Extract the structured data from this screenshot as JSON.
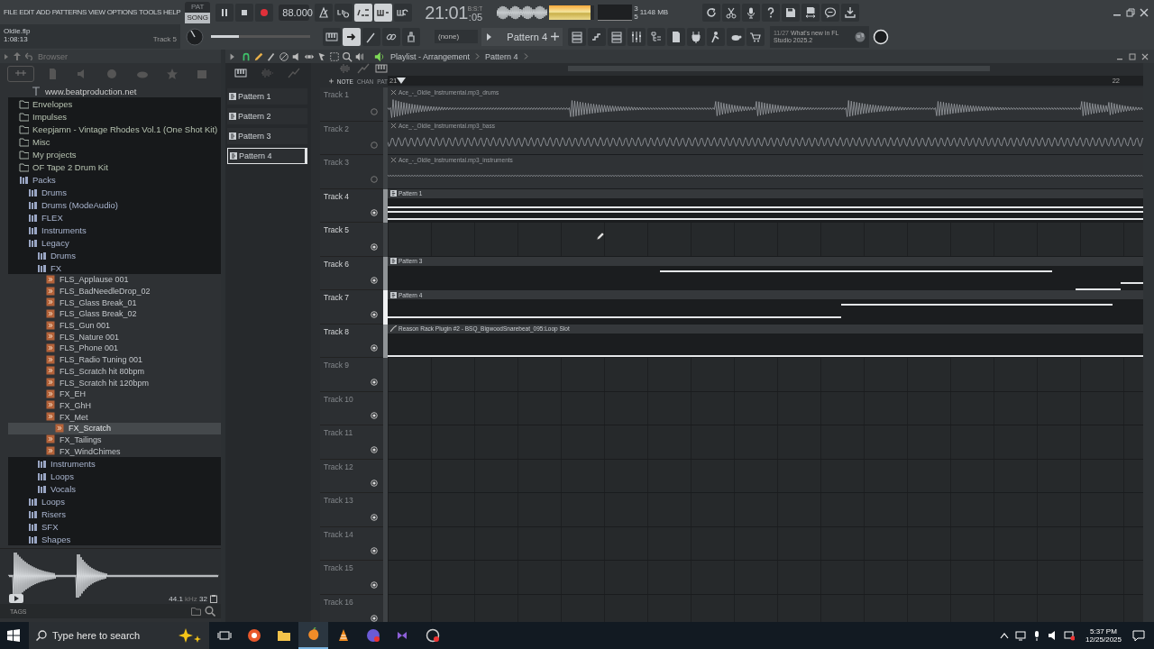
{
  "menu": [
    "FILE",
    "EDIT",
    "ADD",
    "PATTERNS",
    "VIEW",
    "OPTIONS",
    "TOOLS",
    "HELP"
  ],
  "transport": {
    "mode": [
      {
        "label": "PAT",
        "selected": false
      },
      {
        "label": "SONG",
        "selected": true
      }
    ],
    "tempo": "88.000",
    "time": "21:01",
    "time_small": ":05",
    "time_format": "B:S:T",
    "toggles": [
      {
        "on": false
      },
      {
        "on": false
      },
      {
        "on": true
      },
      {
        "on": true
      },
      {
        "on": false
      }
    ]
  },
  "meter": {
    "level": 0.92
  },
  "monitor": {
    "cpu": "3",
    "memory": "1148 MB",
    "polyphony": "5"
  },
  "project": {
    "file": "Oldie.flp",
    "time": "1:08:13",
    "hint": "Track 5"
  },
  "main_slider": {
    "level": 0.28
  },
  "tools": [
    {
      "selected": false
    },
    {
      "selected": true
    },
    {
      "selected": false
    },
    {
      "selected": false
    },
    {
      "selected": false
    }
  ],
  "pattern_picker": {
    "channel": "(none)",
    "pattern": "Pattern 4"
  },
  "news": {
    "date": "11/27",
    "text": "What's new in FL Studio 2025.2"
  },
  "browser": {
    "title": "Browser",
    "tree": [
      {
        "kind": "link",
        "label": "www.beatproduction.net",
        "selected": false
      },
      {
        "kind": "folder",
        "label": "Envelopes",
        "selected": false
      },
      {
        "kind": "folder",
        "label": "Impulses",
        "selected": false
      },
      {
        "kind": "folder",
        "label": "Keepjamn - Vintage Rhodes Vol.1 (One Shot Kit)",
        "selected": false
      },
      {
        "kind": "folder",
        "label": "Misc",
        "selected": false
      },
      {
        "kind": "folder",
        "label": "My projects",
        "selected": false
      },
      {
        "kind": "folder",
        "label": "OF Tape 2 Drum Kit",
        "selected": false
      },
      {
        "kind": "pack",
        "label": "Packs",
        "selected": false,
        "children": [
          {
            "kind": "pack",
            "label": "Drums",
            "selected": false
          },
          {
            "kind": "pack",
            "label": "Drums (ModeAudio)",
            "selected": false
          },
          {
            "kind": "pack",
            "label": "FLEX",
            "selected": false
          },
          {
            "kind": "pack",
            "label": "Instruments",
            "selected": false
          },
          {
            "kind": "pack",
            "label": "Legacy",
            "selected": false,
            "children": [
              {
                "kind": "pack",
                "label": "Drums",
                "selected": false
              },
              {
                "kind": "pack",
                "label": "FX",
                "selected": false,
                "children": [
                  {
                    "kind": "file",
                    "label": "FLS_Applause 001",
                    "selected": false
                  },
                  {
                    "kind": "file",
                    "label": "FLS_BadNeedleDrop_02",
                    "selected": false
                  },
                  {
                    "kind": "file",
                    "label": "FLS_Glass Break_01",
                    "selected": false
                  },
                  {
                    "kind": "file",
                    "label": "FLS_Glass Break_02",
                    "selected": false
                  },
                  {
                    "kind": "file",
                    "label": "FLS_Gun 001",
                    "selected": false
                  },
                  {
                    "kind": "file",
                    "label": "FLS_Nature 001",
                    "selected": false
                  },
                  {
                    "kind": "file",
                    "label": "FLS_Phone 001",
                    "selected": false
                  },
                  {
                    "kind": "file",
                    "label": "FLS_Radio Tuning 001",
                    "selected": false
                  },
                  {
                    "kind": "file",
                    "label": "FLS_Scratch hit 80bpm",
                    "selected": false
                  },
                  {
                    "kind": "file",
                    "label": "FLS_Scratch hit 120bpm",
                    "selected": false
                  },
                  {
                    "kind": "file",
                    "label": "FX_EH",
                    "selected": false
                  },
                  {
                    "kind": "file",
                    "label": "FX_GhH",
                    "selected": false
                  },
                  {
                    "kind": "file",
                    "label": "FX_Met",
                    "selected": false,
                    "children": [
                      {
                        "kind": "file",
                        "label": "FX_Scratch",
                        "selected": true
                      }
                    ]
                  },
                  {
                    "kind": "file",
                    "label": "FX_Tailings",
                    "selected": false
                  },
                  {
                    "kind": "file",
                    "label": "FX_WindChimes",
                    "selected": false
                  }
                ]
              },
              {
                "kind": "pack",
                "label": "Instruments",
                "selected": false
              },
              {
                "kind": "pack",
                "label": "Loops",
                "selected": false
              },
              {
                "kind": "pack",
                "label": "Vocals",
                "selected": false
              }
            ]
          },
          {
            "kind": "pack",
            "label": "Loops",
            "selected": false
          },
          {
            "kind": "pack",
            "label": "Risers",
            "selected": false
          },
          {
            "kind": "pack",
            "label": "SFX",
            "selected": false
          },
          {
            "kind": "pack",
            "label": "Shapes",
            "selected": false
          }
        ]
      }
    ]
  },
  "preview": {
    "sample_rate": "44.1",
    "unit": "kHz",
    "bits": "32"
  },
  "tags_label": "TAGS",
  "playlist": {
    "title": "Playlist - Arrangement",
    "pattern": "Pattern 4",
    "patterns": [
      {
        "label": "Pattern 1",
        "selected": false
      },
      {
        "label": "Pattern 2",
        "selected": false
      },
      {
        "label": "Pattern 3",
        "selected": false
      },
      {
        "label": "Pattern 4",
        "selected": true
      }
    ],
    "toolbar": [
      "NOTE",
      "CHAN",
      "PAT"
    ],
    "ruler": [
      "21",
      "22"
    ],
    "tracks": [
      {
        "name": "Track 1",
        "dimmed": true,
        "selected": false,
        "clip": {
          "kind": "audio",
          "title": "Ace_-_Oldie_Instrumental.mp3_drums"
        }
      },
      {
        "name": "Track 2",
        "dimmed": true,
        "selected": false,
        "clip": {
          "kind": "audio",
          "title": "Ace_-_Oldie_Instrumental.mp3_bass"
        }
      },
      {
        "name": "Track 3",
        "dimmed": true,
        "selected": false,
        "clip": {
          "kind": "audio",
          "title": "Ace_-_Oldie_Instrumental.mp3_instruments"
        }
      },
      {
        "name": "Track 4",
        "dimmed": false,
        "selected": false,
        "clip": {
          "kind": "pattern",
          "title": "Pattern 1"
        }
      },
      {
        "name": "Track 5",
        "dimmed": false,
        "selected": false
      },
      {
        "name": "Track 6",
        "dimmed": false,
        "selected": false,
        "clip": {
          "kind": "pattern",
          "title": "Pattern 3"
        }
      },
      {
        "name": "Track 7",
        "dimmed": false,
        "selected": true,
        "clip": {
          "kind": "pattern",
          "title": "Pattern 4"
        }
      },
      {
        "name": "Track 8",
        "dimmed": false,
        "selected": false,
        "clip": {
          "kind": "automation",
          "title": "Reason Rack Plugin #2 - BSQ_BigwoodSnarebeat_095:Loop Slot"
        }
      },
      {
        "name": "Track 9",
        "dimmed": true,
        "selected": false
      },
      {
        "name": "Track 10",
        "dimmed": true,
        "selected": false
      },
      {
        "name": "Track 11",
        "dimmed": true,
        "selected": false
      },
      {
        "name": "Track 12",
        "dimmed": true,
        "selected": false
      },
      {
        "name": "Track 13",
        "dimmed": true,
        "selected": false
      },
      {
        "name": "Track 14",
        "dimmed": true,
        "selected": false
      },
      {
        "name": "Track 15",
        "dimmed": true,
        "selected": false
      },
      {
        "name": "Track 16",
        "dimmed": true,
        "selected": false
      }
    ]
  },
  "taskbar": {
    "search": {
      "placeholder": "Type here to search"
    },
    "time": "5:37 PM",
    "date": "12/25/2025"
  }
}
